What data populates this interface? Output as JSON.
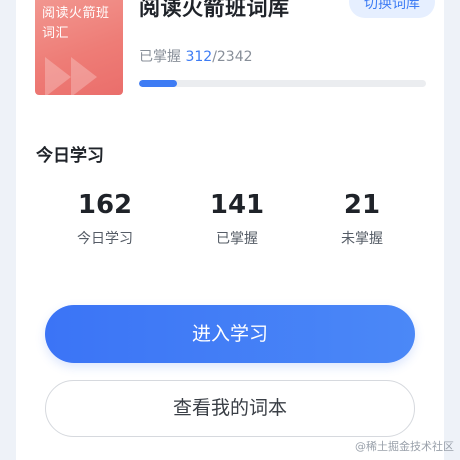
{
  "book": {
    "cover_title": "阅读火箭班词汇",
    "title": "阅读火箭班词库",
    "switch_label": "切换词库",
    "mastered_label": "已掌握 ",
    "mastered_count": "312",
    "total_words": "/2342",
    "progress_fraction": 0.1332
  },
  "today": {
    "section_title": "今日学习",
    "stats": [
      {
        "value": "162",
        "label": "今日学习"
      },
      {
        "value": "141",
        "label": "已掌握"
      },
      {
        "value": "21",
        "label": "未掌握"
      }
    ]
  },
  "actions": {
    "primary_label": "进入学习",
    "secondary_label": "查看我的词本"
  },
  "watermark": "@稀土掘金技术社区",
  "colors": {
    "accent": "#3e7cf4",
    "cover": "#ee7c76"
  }
}
